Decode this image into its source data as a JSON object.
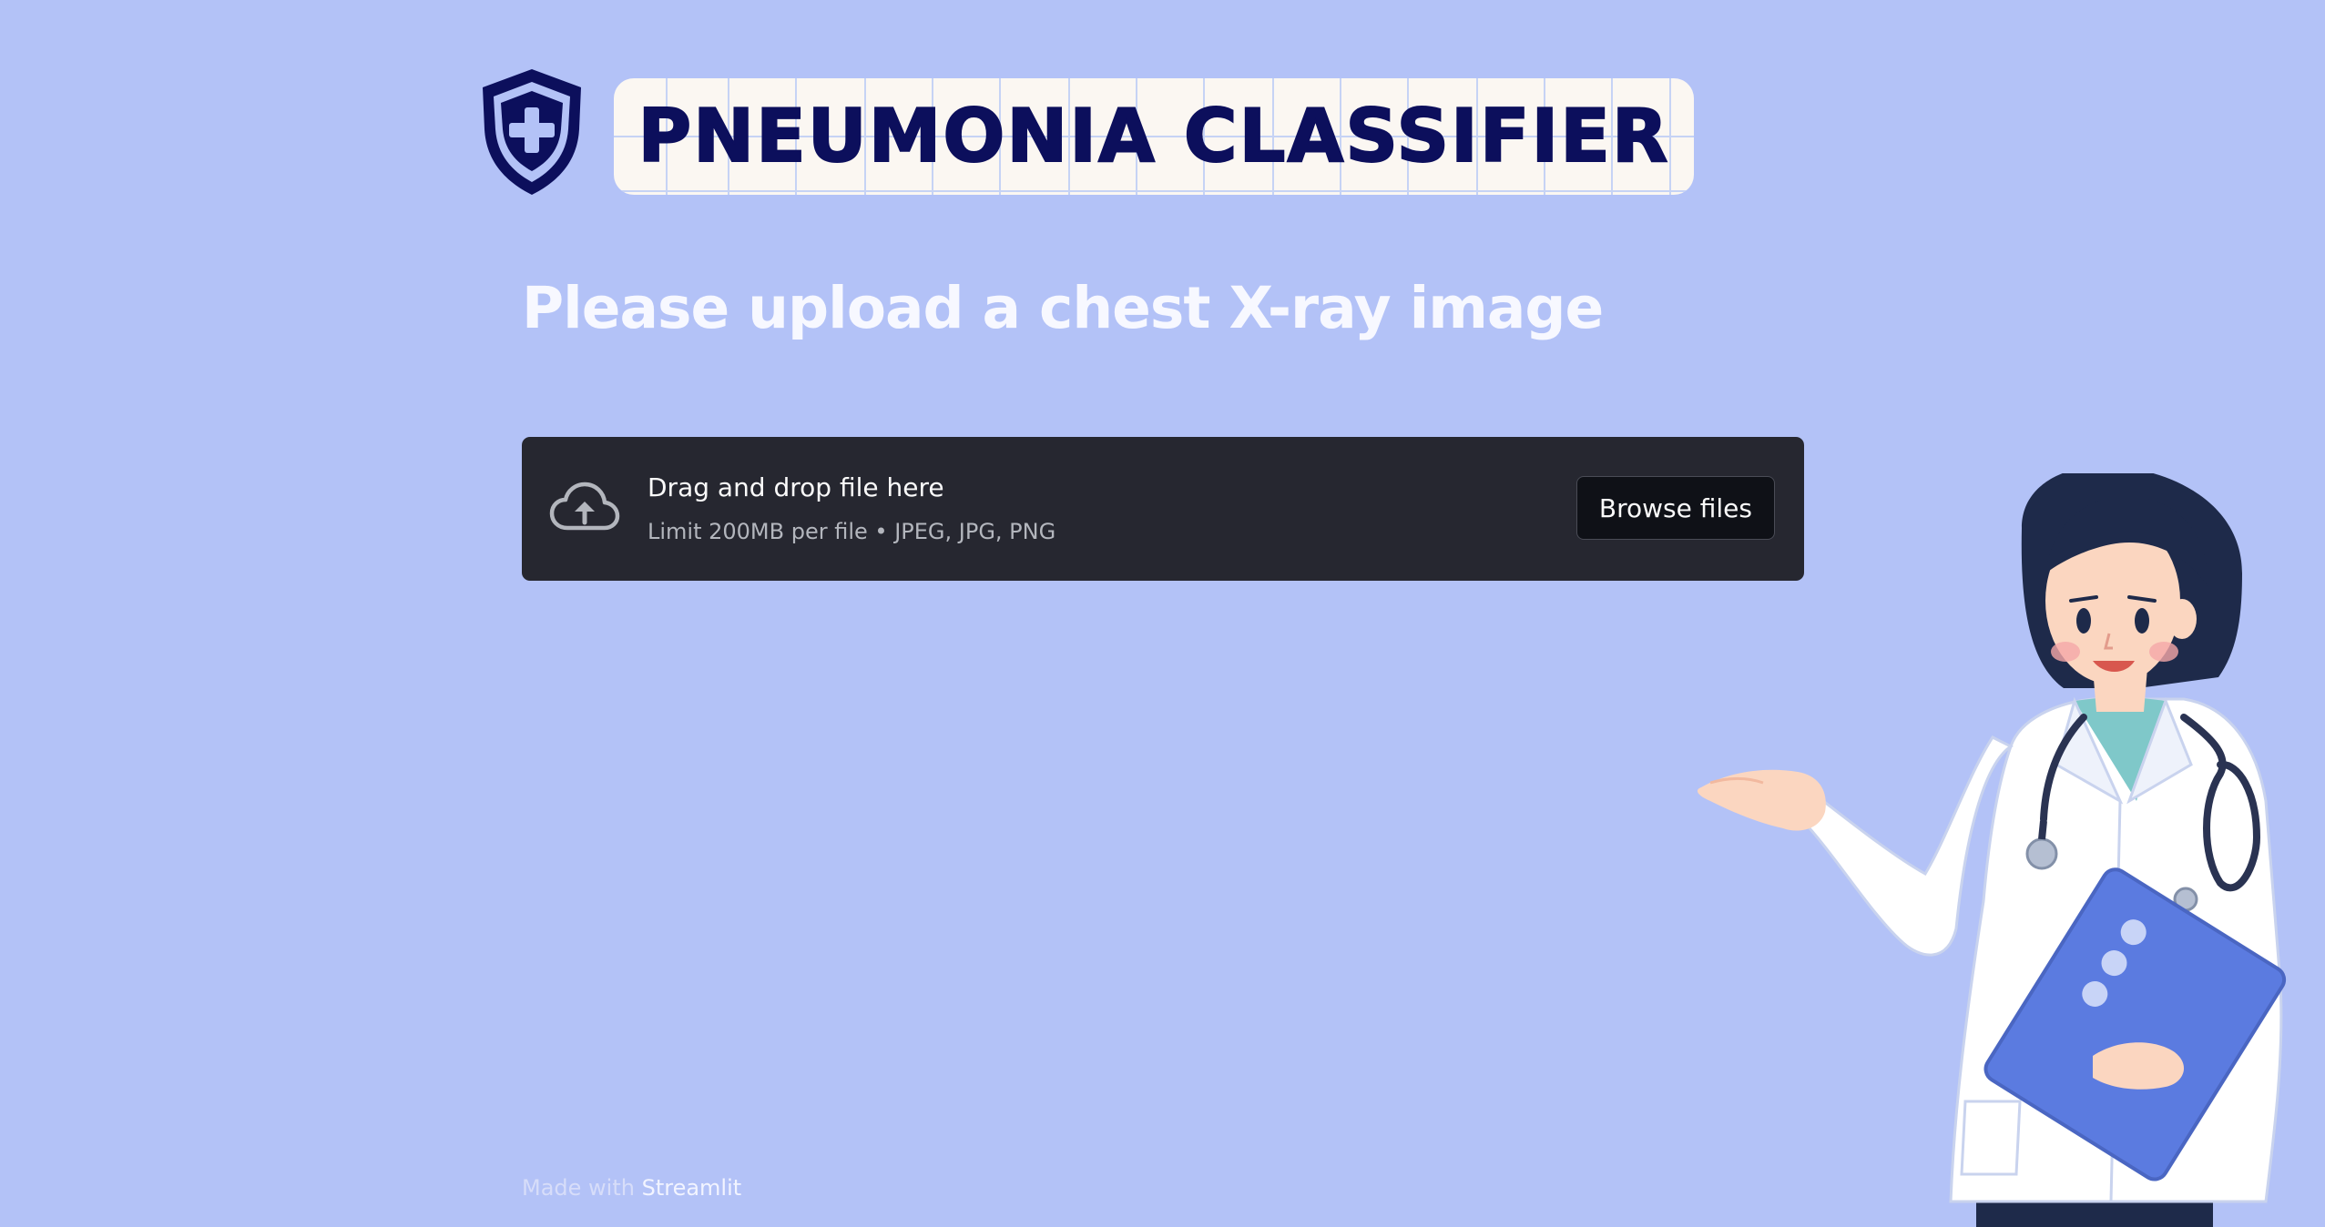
{
  "header": {
    "title": "PNEUMONIA CLASSIFIER",
    "icon": "shield-plus-icon",
    "colors": {
      "navy": "#0c0f5c",
      "plate": "#fbf7f2"
    }
  },
  "main": {
    "heading": "Please upload a chest X-ray image"
  },
  "uploader": {
    "icon": "cloud-upload-icon",
    "drop_label": "Drag and drop file here",
    "limit_label": "Limit 200MB per file • JPEG, JPG, PNG",
    "browse_label": "Browse files"
  },
  "footer": {
    "prefix": "Made with ",
    "brand": "Streamlit"
  },
  "illustration": {
    "name": "doctor-illustration"
  },
  "theme": {
    "background": "#b3c2f7",
    "uploader_bg": "#262730",
    "button_bg": "#0f1117"
  }
}
